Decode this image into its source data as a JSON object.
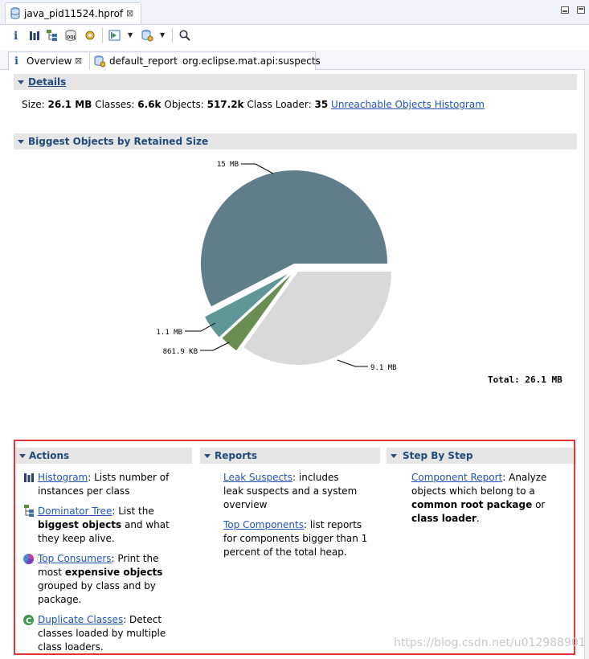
{
  "editor_tab": {
    "title": "java_pid11524.hprof",
    "close": "⊠"
  },
  "inner_tabs": [
    {
      "label": "Overview",
      "close": "⊠"
    },
    {
      "label": "default_report",
      "sub": "org.eclipse.mat.api:suspects"
    }
  ],
  "details": {
    "title": "Details",
    "size_label": "Size:",
    "size_value": "26.1 MB",
    "classes_label": "Classes:",
    "classes_value": "6.6k",
    "objects_label": "Objects:",
    "objects_value": "517.2k",
    "classloader_label": "Class Loader:",
    "classloader_value": "35",
    "link": "Unreachable Objects Histogram"
  },
  "biggest": {
    "title": "Biggest Objects by Retained Size",
    "total": "Total: 26.1 MB"
  },
  "chart_data": {
    "type": "pie",
    "unit": "MB",
    "slices": [
      {
        "label": "15 MB",
        "value": 15.0,
        "color": "#607d8b"
      },
      {
        "label": "9.1 MB",
        "value": 9.1,
        "color": "#d9d9d9"
      },
      {
        "label": "861.9 KB",
        "value": 0.8417,
        "color": "#6a8d52"
      },
      {
        "label": "1.1 MB",
        "value": 1.1,
        "color": "#5f9696"
      }
    ],
    "total_label": "Total: 26.1 MB"
  },
  "actions": {
    "title": "Actions",
    "items": [
      {
        "link": "Histogram",
        "t1": ": Lists number of instances per class",
        "icon": "histogram-icon"
      },
      {
        "link": "Dominator Tree",
        "t1": ": List the ",
        "b1": "biggest objects",
        "t2": " and what they keep alive.",
        "icon": "dominator-tree-icon"
      },
      {
        "link": "Top Consumers",
        "t1": ": Print the most ",
        "b1": "expensive objects",
        "t2": " grouped by class and by package.",
        "icon": "top-consumers-icon"
      },
      {
        "link": "Duplicate Classes",
        "t1": ": Detect classes loaded by multiple class loaders.",
        "icon": "duplicate-classes-icon"
      }
    ]
  },
  "reports": {
    "title": "Reports",
    "items": [
      {
        "link": "Leak Suspects",
        "t1": ": includes leak suspects and a system overview"
      },
      {
        "link": "Top Components",
        "t1": ": list reports for components bigger than 1 percent of the total heap."
      }
    ]
  },
  "step": {
    "title": "Step By Step",
    "link": "Component Report",
    "t1": ": Analyze objects which belong to a ",
    "b1": "common root package",
    "t2": " or ",
    "b2": "class loader",
    "t3": "."
  },
  "watermark": "https://blog.csdn.net/u012988901"
}
